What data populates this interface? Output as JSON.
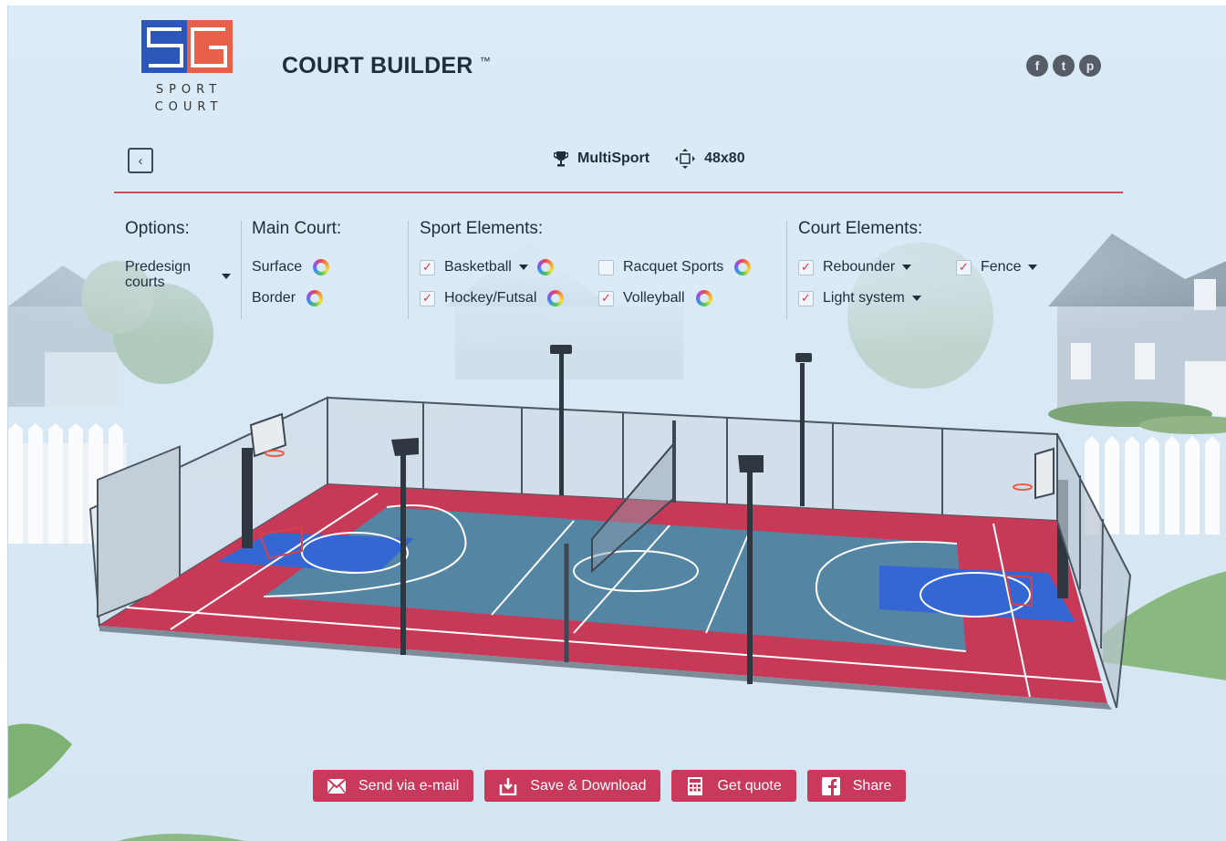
{
  "brand": {
    "logo_text_line1": "SPORT",
    "logo_text_line2": "COURT",
    "colors": {
      "blue": "#2b58b8",
      "red": "#e6604a",
      "accent": "#c8395c",
      "divider": "#c75050"
    }
  },
  "header": {
    "title": "COURT BUILDER",
    "title_mark": "™",
    "social": [
      {
        "icon": "facebook-icon",
        "glyph": "f"
      },
      {
        "icon": "twitter-icon",
        "glyph": "t"
      },
      {
        "icon": "pinterest-icon",
        "glyph": "p"
      }
    ]
  },
  "toolbar": {
    "back_glyph": "‹",
    "sport_icon": "trophy-icon",
    "sport_label": "MultiSport",
    "size_icon": "move-arrows-icon",
    "size_label": "48x80"
  },
  "panel": {
    "options": {
      "title": "Options:",
      "predesign_line1": "Predesign",
      "predesign_line2": "courts"
    },
    "main_court": {
      "title": "Main Court:",
      "surface": "Surface",
      "border": "Border"
    },
    "sport_elements": {
      "title": "Sport Elements:",
      "items": [
        {
          "label": "Basketball",
          "checked": true,
          "dropdown": true
        },
        {
          "label": "Racquet Sports",
          "checked": false,
          "dropdown": false
        },
        {
          "label": "Hockey/Futsal",
          "checked": true,
          "dropdown": false
        },
        {
          "label": "Volleyball",
          "checked": true,
          "dropdown": false
        }
      ]
    },
    "court_elements": {
      "title": "Court Elements:",
      "items": [
        {
          "label": "Rebounder",
          "checked": true
        },
        {
          "label": "Fence",
          "checked": true
        },
        {
          "label": "Light system",
          "checked": true
        }
      ]
    }
  },
  "actions": [
    {
      "label": "Send via e-mail",
      "icon": "envelope-icon"
    },
    {
      "label": "Save & Download",
      "icon": "download-icon"
    },
    {
      "label": "Get quote",
      "icon": "calculator-icon"
    },
    {
      "label": "Share",
      "icon": "facebook-icon"
    }
  ],
  "checkmark": "✓"
}
